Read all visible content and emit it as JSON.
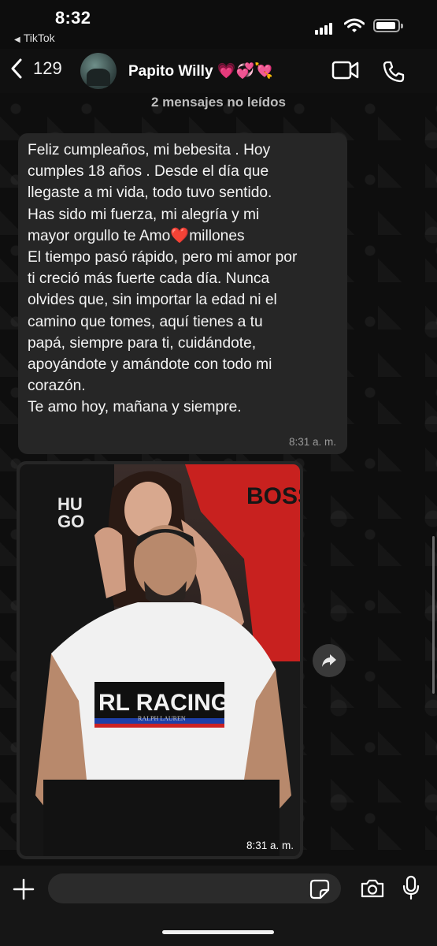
{
  "status_bar": {
    "time": "8:32",
    "back_app": "TikTok"
  },
  "header": {
    "unread_count": "129",
    "contact_name": "Papito Willy 💗💞💘",
    "icons": [
      "back-chevron-icon",
      "video-call-icon",
      "phone-icon"
    ]
  },
  "chat": {
    "unread_banner": "2 mensajes no leídos",
    "message": {
      "lines": [
        "Feliz cumpleaños, mi bebesita . Hoy",
        "cumples 18 años . Desde el día que",
        "llegaste a mi vida, todo tuvo sentido.",
        "Has sido mi fuerza, mi alegría y mi",
        "mayor orgullo te Amo",
        "El tiempo pasó rápido, pero mi amor por",
        "ti creció más fuerte cada día. Nunca",
        "olvides que, sin importar la edad ni el",
        "camino que tomes, aquí tienes a tu",
        "papá, siempre para ti, cuidándote,",
        "apoyándote y amándote con todo mi",
        "corazón.",
        "Te amo hoy, mañana y siempre."
      ],
      "heart_emoji": "❤️",
      "line5_suffix": "millones",
      "time": "8:31 a. m."
    },
    "photo_message": {
      "time": "8:31 a. m.",
      "shirt_text": "RL RACING",
      "shirt_sub": "RALPH LAUREN",
      "cap_text_1": "HU",
      "cap_text_2": "GO",
      "red_shirt_text": "BOSS"
    }
  },
  "input_bar": {
    "placeholder": "",
    "icons": [
      "plus-icon",
      "sticker-icon",
      "camera-icon",
      "microphone-icon"
    ]
  },
  "colors": {
    "bubble": "#262626",
    "background": "#0d0d0d",
    "heart": "#e0242b"
  }
}
